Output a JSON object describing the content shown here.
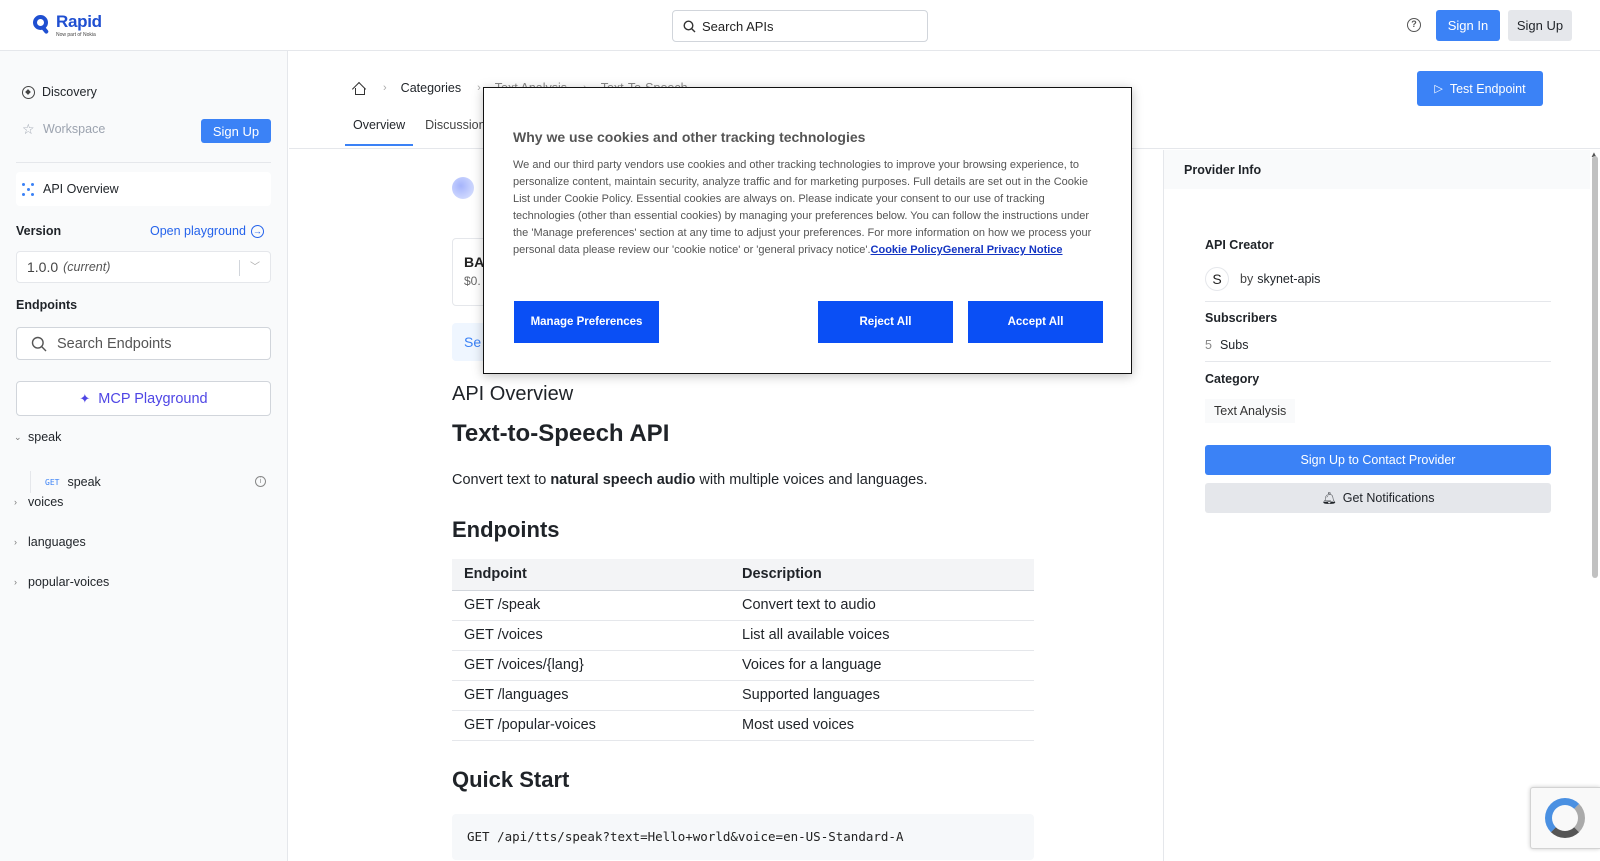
{
  "header": {
    "logo_name": "Rapid",
    "logo_sub": "Now part of Nokia",
    "search_placeholder": "Search APIs",
    "sign_in": "Sign In",
    "sign_up": "Sign Up"
  },
  "sidebar": {
    "discovery": "Discovery",
    "workspace": "Workspace",
    "sign_up": "Sign Up",
    "api_overview": "API Overview",
    "version_label": "Version",
    "open_playground": "Open playground",
    "version_value": "1.0.0",
    "version_tag": "(current)",
    "endpoints_label": "Endpoints",
    "search_endpoints_placeholder": "Search Endpoints",
    "mcp_playground": "MCP Playground",
    "groups": [
      {
        "label": "speak",
        "expanded": true
      },
      {
        "label": "voices",
        "expanded": false
      },
      {
        "label": "languages",
        "expanded": false
      },
      {
        "label": "popular-voices",
        "expanded": false
      }
    ],
    "child": {
      "method": "GET",
      "label": "speak"
    }
  },
  "main": {
    "breadcrumb": [
      "Categories",
      "Text Analysis",
      "Text-To-Speech"
    ],
    "test_endpoint": "Test Endpoint",
    "tabs": [
      "Overview",
      "Discussions"
    ],
    "basic_card": {
      "title": "BA",
      "price": "$0."
    },
    "see_button": "Se",
    "overview_heading": "API Overview",
    "api_title": "Text-to-Speech API",
    "desc_pre": "Convert text to ",
    "desc_bold": "natural speech audio",
    "desc_post": " with multiple voices and languages.",
    "endpoints_heading": "Endpoints",
    "table": {
      "headers": [
        "Endpoint",
        "Description"
      ],
      "rows": [
        [
          "GET /speak",
          "Convert text to audio"
        ],
        [
          "GET /voices",
          "List all available voices"
        ],
        [
          "GET /voices/{lang}",
          "Voices for a language"
        ],
        [
          "GET /languages",
          "Supported languages"
        ],
        [
          "GET /popular-voices",
          "Most used voices"
        ]
      ]
    },
    "quick_start_heading": "Quick Start",
    "quick_start_code": "GET /api/tts/speak?text=Hello+world&voice=en-US-Standard-A"
  },
  "provider": {
    "heading": "Provider Info",
    "creator_label": "API Creator",
    "creator_initial": "S",
    "creator_by": "by",
    "creator_name": "skynet-apis",
    "subscribers_label": "Subscribers",
    "subscribers_count": "5",
    "subscribers_unit": "Subs",
    "category_label": "Category",
    "category_value": "Text Analysis",
    "contact_button": "Sign Up to Contact Provider",
    "notify_button": "Get Notifications"
  },
  "cookie": {
    "title": "Why we use cookies and other tracking technologies",
    "body": "We and our third party vendors use cookies and other tracking technologies to improve your browsing experience, to personalize content, maintain security, analyze traffic and for marketing purposes. Full details are set out in the Cookie List under Cookie Policy. Essential cookies are always on. Please indicate your consent to our use of tracking technologies (other than essential cookies) by managing your preferences below. You can follow the instructions under the 'Manage preferences' section at any time to adjust your preferences. For more information on how we process your personal data please review our 'cookie notice' or 'general privacy notice'.",
    "link_policy": "Cookie Policy",
    "link_privacy": "General Privacy Notice",
    "manage": "Manage Preferences",
    "reject": "Reject All",
    "accept": "Accept All"
  },
  "colors": {
    "brand": "#1f4fd1",
    "primary": "#3b82f6",
    "cookie_button": "#0a4ff5"
  }
}
